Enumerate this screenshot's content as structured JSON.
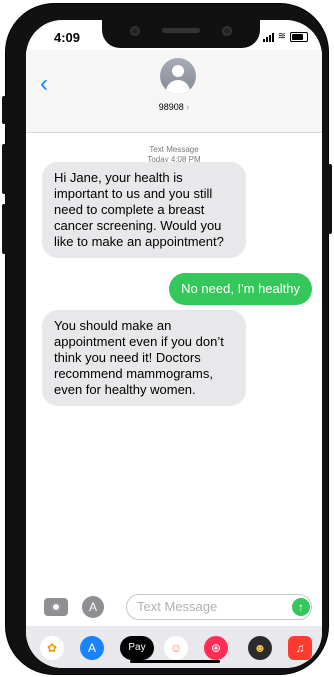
{
  "status_bar": {
    "time": "4:09"
  },
  "header": {
    "back_label": "‹",
    "contact_name": "98908",
    "contact_chevron": "›"
  },
  "thread": {
    "meta_type": "Text Message",
    "meta_time": "Today 4:08 PM"
  },
  "messages": [
    {
      "direction": "incoming",
      "text": "Hi Jane, your health is important to us and you still need to complete a breast cancer screening. Would you like to make an appointment?"
    },
    {
      "direction": "outgoing",
      "text": "No need, I'm healthy"
    },
    {
      "direction": "incoming",
      "text": "You should make an appointment even if you don’t think you need it! Doctors recommend mammograms, even for healthy women."
    }
  ],
  "composer": {
    "placeholder": "Text Message",
    "send_icon": "↑"
  },
  "app_strip": {
    "items": [
      {
        "name": "photos-icon",
        "glyph": "✿",
        "color": "#ff9500"
      },
      {
        "name": "app-store-icon",
        "glyph": "A",
        "color": "#1a82fb"
      },
      {
        "name": "apple-pay-icon",
        "glyph": "Pay",
        "color": "#000000"
      },
      {
        "name": "memoji-icon",
        "glyph": "☺",
        "color": "#ff7f50"
      },
      {
        "name": "search-images-icon",
        "glyph": "⊕",
        "color": "#ff2d55"
      },
      {
        "name": "animoji-icon",
        "glyph": "☻",
        "color": "#8b5a2b"
      },
      {
        "name": "music-icon",
        "glyph": "♫",
        "color": "#ff3b30"
      }
    ]
  },
  "colors": {
    "accent": "#1a82fb",
    "outgoing_bubble": "#34c759",
    "incoming_bubble": "#e8e8eb"
  }
}
